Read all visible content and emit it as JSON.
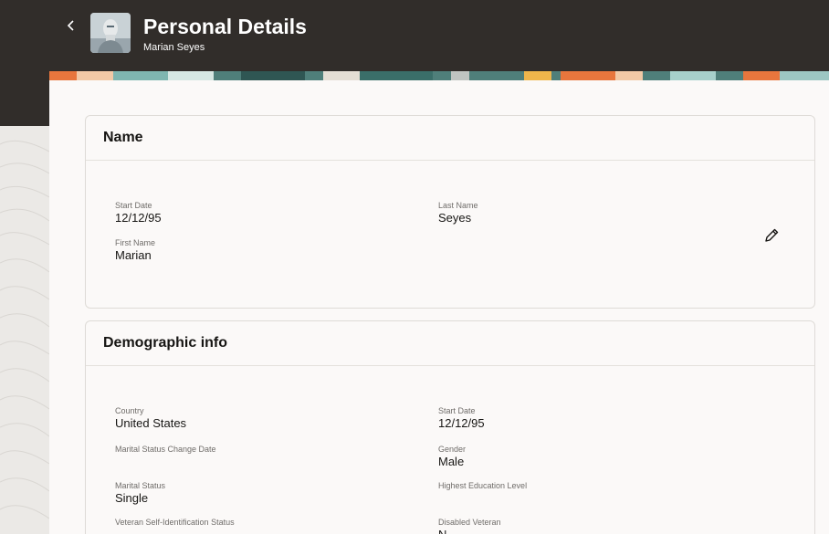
{
  "header": {
    "title": "Personal Details",
    "subtitle": "Marian Seyes",
    "back_icon": "chevron-left-icon",
    "avatar_icon": "user-avatar"
  },
  "colors": {
    "header_bg": "#312d2a",
    "card_bg": "#fbf9f8",
    "banner_teal": "#4f7f7a",
    "banner_orange": "#e8763d"
  },
  "sections": {
    "name": {
      "title": "Name",
      "edit_icon": "pencil-icon",
      "fields": [
        {
          "label": "Start Date",
          "value": "12/12/95"
        },
        {
          "label": "Last Name",
          "value": "Seyes"
        },
        {
          "label": "First Name",
          "value": "Marian"
        }
      ]
    },
    "demographic": {
      "title": "Demographic info",
      "fields": [
        {
          "label": "Country",
          "value": "United States"
        },
        {
          "label": "Start Date",
          "value": "12/12/95"
        },
        {
          "label": "Marital Status Change Date",
          "value": ""
        },
        {
          "label": "Gender",
          "value": "Male"
        },
        {
          "label": "Marital Status",
          "value": "Single"
        },
        {
          "label": "Highest Education Level",
          "value": ""
        },
        {
          "label": "Veteran Self-Identification Status",
          "value": ""
        },
        {
          "label": "Disabled Veteran",
          "value": "N"
        }
      ]
    }
  }
}
